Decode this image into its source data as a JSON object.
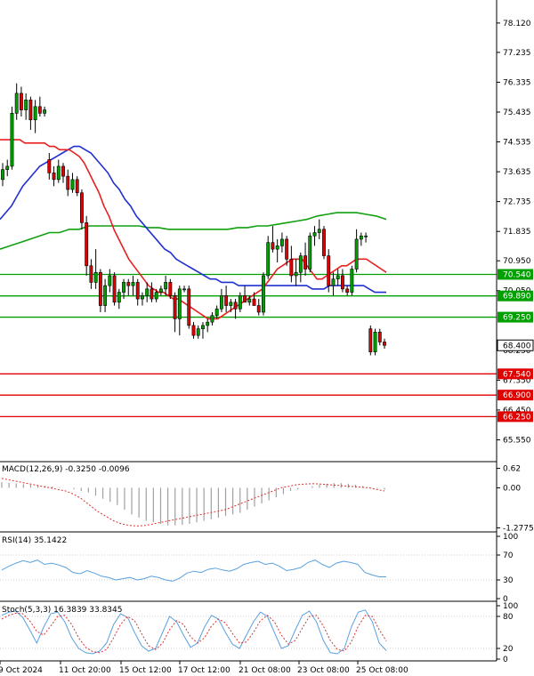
{
  "chart_data": {
    "type": "candlestick",
    "main": {
      "price_ticks": [
        "78.120",
        "77.235",
        "76.335",
        "75.435",
        "74.535",
        "73.635",
        "72.735",
        "71.835",
        "70.950",
        "70.050",
        "68.250",
        "67.350",
        "66.450",
        "65.550"
      ],
      "ylim": [
        65.0,
        78.6
      ],
      "levels": [
        {
          "label": "70.540",
          "value": 70.54,
          "color": "#00a000"
        },
        {
          "label": "69.890",
          "value": 69.89,
          "color": "#00a000"
        },
        {
          "label": "69.250",
          "value": 69.25,
          "color": "#00a000"
        },
        {
          "label": "67.540",
          "value": 67.54,
          "color": "#e00000"
        },
        {
          "label": "66.900",
          "value": 66.9,
          "color": "#e00000"
        },
        {
          "label": "66.250",
          "value": 66.25,
          "color": "#e00000"
        }
      ],
      "current_price": {
        "label": "68.400",
        "value": 68.4
      },
      "candles": [
        [
          73.4,
          73.9,
          73.2,
          73.7
        ],
        [
          73.7,
          74.0,
          73.5,
          73.8
        ],
        [
          73.8,
          75.6,
          73.7,
          75.4
        ],
        [
          75.4,
          76.3,
          75.2,
          76.0
        ],
        [
          76.0,
          76.2,
          75.3,
          75.5
        ],
        [
          75.5,
          76.0,
          75.2,
          75.8
        ],
        [
          75.8,
          75.9,
          74.9,
          75.2
        ],
        [
          75.2,
          75.8,
          74.8,
          75.6
        ],
        [
          75.6,
          75.9,
          75.3,
          75.4
        ],
        [
          75.4,
          75.6,
          75.3,
          75.5
        ],
        [
          74.0,
          74.2,
          73.4,
          73.6
        ],
        [
          73.6,
          73.8,
          73.2,
          73.4
        ],
        [
          73.4,
          74.0,
          73.3,
          73.8
        ],
        [
          73.8,
          73.9,
          73.3,
          73.5
        ],
        [
          73.5,
          73.7,
          72.9,
          73.1
        ],
        [
          73.1,
          73.6,
          73.0,
          73.4
        ],
        [
          73.4,
          73.5,
          72.9,
          73.0
        ],
        [
          73.0,
          73.1,
          71.9,
          72.1
        ],
        [
          72.1,
          72.3,
          70.5,
          70.8
        ],
        [
          70.8,
          71.0,
          70.1,
          70.3
        ],
        [
          70.3,
          71.3,
          70.1,
          70.6
        ],
        [
          70.6,
          70.7,
          69.4,
          69.6
        ],
        [
          69.6,
          70.4,
          69.4,
          70.2
        ],
        [
          70.2,
          70.7,
          70.0,
          70.5
        ],
        [
          70.5,
          70.6,
          69.6,
          69.7
        ],
        [
          69.7,
          70.1,
          69.5,
          70.0
        ],
        [
          70.0,
          70.4,
          69.8,
          70.3
        ],
        [
          70.3,
          70.4,
          69.9,
          70.2
        ],
        [
          70.2,
          70.5,
          69.9,
          70.3
        ],
        [
          70.3,
          70.4,
          69.6,
          69.8
        ],
        [
          69.8,
          70.0,
          69.6,
          69.9
        ],
        [
          69.9,
          70.3,
          69.7,
          70.1
        ],
        [
          70.1,
          70.3,
          69.7,
          69.8
        ],
        [
          69.8,
          70.1,
          69.7,
          70.0
        ],
        [
          70.0,
          70.2,
          69.9,
          70.1
        ],
        [
          70.1,
          70.5,
          69.9,
          70.3
        ],
        [
          70.3,
          70.4,
          69.8,
          69.9
        ],
        [
          69.9,
          70.0,
          68.8,
          69.2
        ],
        [
          69.2,
          70.2,
          68.7,
          70.1
        ],
        [
          70.1,
          70.2,
          70.0,
          70.1
        ],
        [
          70.1,
          70.2,
          68.9,
          69.0
        ],
        [
          69.0,
          69.1,
          68.6,
          68.7
        ],
        [
          68.7,
          69.0,
          68.6,
          68.9
        ],
        [
          68.9,
          69.1,
          68.6,
          69.0
        ],
        [
          69.0,
          69.2,
          68.8,
          69.1
        ],
        [
          69.1,
          69.4,
          69.0,
          69.3
        ],
        [
          69.3,
          69.6,
          69.2,
          69.5
        ],
        [
          69.5,
          70.1,
          69.4,
          69.9
        ],
        [
          69.9,
          70.2,
          69.4,
          69.6
        ],
        [
          69.6,
          69.8,
          69.4,
          69.7
        ],
        [
          69.7,
          69.8,
          69.2,
          69.5
        ],
        [
          69.5,
          70.0,
          69.4,
          69.9
        ],
        [
          69.9,
          70.2,
          69.8,
          69.7
        ],
        [
          69.7,
          69.9,
          69.6,
          69.8
        ],
        [
          69.8,
          70.0,
          69.6,
          69.6
        ],
        [
          69.6,
          69.8,
          69.3,
          69.4
        ],
        [
          69.4,
          70.6,
          69.3,
          70.5
        ],
        [
          70.5,
          71.7,
          70.4,
          71.5
        ],
        [
          71.5,
          72.0,
          71.2,
          71.3
        ],
        [
          71.3,
          71.6,
          70.9,
          71.4
        ],
        [
          71.4,
          71.8,
          71.2,
          71.6
        ],
        [
          71.6,
          71.7,
          70.8,
          71.0
        ],
        [
          71.0,
          71.4,
          70.3,
          70.5
        ],
        [
          70.5,
          71.0,
          70.2,
          70.6
        ],
        [
          70.6,
          71.2,
          70.3,
          71.1
        ],
        [
          71.1,
          71.5,
          70.5,
          70.7
        ],
        [
          70.7,
          71.8,
          70.6,
          71.7
        ],
        [
          71.7,
          72.0,
          71.4,
          71.8
        ],
        [
          71.8,
          72.2,
          71.6,
          71.9
        ],
        [
          71.9,
          72.0,
          71.0,
          71.1
        ],
        [
          71.1,
          71.3,
          70.0,
          70.2
        ],
        [
          70.2,
          70.6,
          69.9,
          70.4
        ],
        [
          70.4,
          70.7,
          70.2,
          70.5
        ],
        [
          70.5,
          70.7,
          70.0,
          70.1
        ],
        [
          70.1,
          70.2,
          69.9,
          70.0
        ],
        [
          70.0,
          70.8,
          69.9,
          70.7
        ],
        [
          70.7,
          71.9,
          70.6,
          71.6
        ],
        [
          71.6,
          71.8,
          71.4,
          71.7
        ],
        [
          71.7,
          71.8,
          71.5,
          71.7
        ],
        [
          68.9,
          69.0,
          68.1,
          68.2
        ],
        [
          68.2,
          68.9,
          68.1,
          68.8
        ],
        [
          68.8,
          68.9,
          68.4,
          68.5
        ],
        [
          68.5,
          68.6,
          68.3,
          68.4
        ]
      ],
      "ma_fast": [
        74.6,
        74.6,
        74.6,
        74.6,
        74.6,
        74.5,
        74.5,
        74.5,
        74.5,
        74.5,
        74.4,
        74.4,
        74.3,
        74.3,
        74.3,
        74.2,
        74.1,
        73.9,
        73.6,
        73.3,
        73.0,
        72.6,
        72.3,
        71.9,
        71.6,
        71.3,
        71.0,
        70.8,
        70.6,
        70.4,
        70.2,
        70.1,
        70.0,
        70.0,
        69.9,
        69.8,
        69.8,
        69.7,
        69.6,
        69.5,
        69.4,
        69.3,
        69.2,
        69.2,
        69.2,
        69.3,
        69.4,
        69.5,
        69.6,
        69.7,
        69.8,
        69.9,
        70.0,
        70.1,
        70.3,
        70.5,
        70.7,
        70.8,
        70.9,
        71.0,
        71.0,
        71.0,
        70.8,
        70.6,
        70.4,
        70.4,
        70.5,
        70.6,
        70.7,
        70.8,
        70.8,
        70.9,
        71.0,
        71.0,
        71.0,
        70.9,
        70.8,
        70.7,
        70.6
      ],
      "ma_mid": [
        72.2,
        72.4,
        72.6,
        72.9,
        73.2,
        73.4,
        73.6,
        73.8,
        73.9,
        74.0,
        74.1,
        74.2,
        74.3,
        74.4,
        74.4,
        74.3,
        74.2,
        74.0,
        73.8,
        73.6,
        73.3,
        73.1,
        72.8,
        72.6,
        72.3,
        72.1,
        71.9,
        71.7,
        71.5,
        71.3,
        71.2,
        71.0,
        70.9,
        70.8,
        70.7,
        70.6,
        70.5,
        70.4,
        70.4,
        70.3,
        70.3,
        70.3,
        70.2,
        70.2,
        70.2,
        70.2,
        70.2,
        70.2,
        70.2,
        70.2,
        70.2,
        70.2,
        70.2,
        70.2,
        70.2,
        70.1,
        70.1,
        70.1,
        70.2,
        70.2,
        70.2,
        70.2,
        70.2,
        70.2,
        70.2,
        70.1,
        70.0,
        70.0,
        70.0
      ],
      "ma_slow": [
        71.3,
        71.4,
        71.5,
        71.6,
        71.7,
        71.8,
        71.8,
        71.9,
        71.9,
        72.0,
        72.0,
        72.0,
        72.0,
        72.0,
        72.0,
        71.95,
        71.95,
        71.9,
        71.9,
        71.9,
        71.9,
        71.9,
        71.9,
        71.9,
        71.95,
        71.95,
        72.0,
        72.0,
        72.05,
        72.1,
        72.15,
        72.2,
        72.3,
        72.35,
        72.4,
        72.4,
        72.4,
        72.35,
        72.3,
        72.2
      ]
    },
    "macd": {
      "label": "MACD(12,26,9) -0.3250 -0.0096",
      "ticks": [
        "0.62",
        "0.00",
        "-1.2775"
      ],
      "ylim": [
        -1.35,
        0.75
      ],
      "hist": [
        0.18,
        0.16,
        0.14,
        0.12,
        0.1,
        0.08,
        0.06,
        0.04,
        0.02,
        0.0,
        -0.05,
        -0.1,
        -0.15,
        -0.25,
        -0.35,
        -0.45,
        -0.55,
        -0.7,
        -0.85,
        -0.95,
        -1.05,
        -1.1,
        -1.15,
        -1.2,
        -1.2,
        -1.18,
        -1.15,
        -1.1,
        -1.05,
        -1.0,
        -0.95,
        -0.9,
        -0.85,
        -0.8,
        -0.7,
        -0.6,
        -0.5,
        -0.4,
        -0.3,
        -0.2,
        -0.1,
        -0.05,
        0.0,
        0.05,
        0.1,
        0.13,
        0.15,
        0.15,
        0.13,
        0.1,
        0.06,
        0.02,
        -0.02,
        -0.06
      ],
      "signal": [
        0.3,
        0.25,
        0.2,
        0.15,
        0.1,
        0.05,
        0.0,
        -0.05,
        -0.1,
        -0.2,
        -0.35,
        -0.55,
        -0.75,
        -0.9,
        -1.05,
        -1.15,
        -1.2,
        -1.22,
        -1.2,
        -1.15,
        -1.1,
        -1.05,
        -1.0,
        -0.95,
        -0.9,
        -0.85,
        -0.8,
        -0.75,
        -0.7,
        -0.6,
        -0.5,
        -0.4,
        -0.3,
        -0.2,
        -0.1,
        0.0,
        0.05,
        0.1,
        0.12,
        0.13,
        0.12,
        0.1,
        0.08,
        0.06,
        0.04,
        0.02,
        0.0,
        -0.05,
        -0.1
      ]
    },
    "rsi": {
      "label": "RSI(14) 35.1422",
      "ticks": [
        "100",
        "70",
        "30",
        "0"
      ],
      "ylim": [
        0,
        100
      ],
      "levels": [
        70,
        30
      ],
      "values": [
        46,
        52,
        57,
        61,
        58,
        62,
        55,
        57,
        54,
        50,
        42,
        40,
        45,
        41,
        36,
        34,
        30,
        32,
        34,
        30,
        32,
        36,
        34,
        30,
        28,
        33,
        41,
        44,
        42,
        47,
        49,
        46,
        44,
        48,
        55,
        58,
        60,
        55,
        57,
        52,
        45,
        47,
        50,
        58,
        62,
        55,
        50,
        57,
        60,
        58,
        55,
        42,
        38,
        35,
        35
      ]
    },
    "stoch": {
      "label": "Stoch(5,3,3) 16.3839 33.8345",
      "ticks": [
        "100",
        "80",
        "20",
        "0"
      ],
      "ylim": [
        0,
        100
      ],
      "levels": [
        80,
        20
      ],
      "k": [
        82,
        88,
        90,
        78,
        55,
        30,
        60,
        85,
        88,
        70,
        40,
        20,
        12,
        10,
        15,
        30,
        65,
        85,
        78,
        50,
        25,
        15,
        20,
        50,
        80,
        70,
        45,
        22,
        30,
        60,
        82,
        75,
        50,
        28,
        20,
        45,
        70,
        88,
        80,
        50,
        20,
        25,
        55,
        82,
        90,
        70,
        35,
        12,
        10,
        20,
        60,
        88,
        92,
        70,
        30,
        16
      ],
      "d": [
        75,
        82,
        86,
        85,
        72,
        52,
        45,
        62,
        80,
        82,
        65,
        40,
        22,
        14,
        12,
        18,
        40,
        65,
        80,
        72,
        48,
        25,
        18,
        30,
        55,
        72,
        65,
        42,
        30,
        40,
        62,
        75,
        68,
        48,
        30,
        32,
        50,
        72,
        82,
        70,
        45,
        28,
        35,
        58,
        80,
        82,
        62,
        35,
        18,
        15,
        32,
        62,
        82,
        80,
        55,
        34
      ]
    },
    "x_labels": [
      "9 Oct 2024",
      "11 Oct 20:00",
      "15 Oct 12:00",
      "17 Oct 12:00",
      "21 Oct 08:00",
      "23 Oct 08:00",
      "25 Oct 08:00"
    ],
    "colors": {
      "bull": "#00a000",
      "bear": "#e00000",
      "ma_fast": "#e82020",
      "ma_mid": "#2030d0",
      "ma_slow": "#10a010",
      "indicator_line": "#5aa0e0",
      "macd_signal": "#e03030"
    }
  }
}
